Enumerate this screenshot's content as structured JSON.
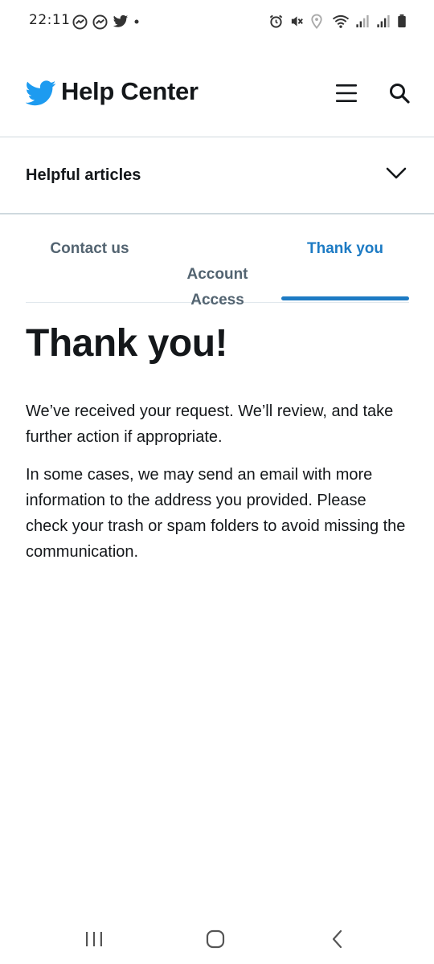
{
  "status_bar": {
    "time": "22:11",
    "left_icons": [
      "messenger-icon",
      "messenger-icon",
      "twitter-icon",
      "dot-icon"
    ],
    "right_icons": [
      "alarm-icon",
      "mute-icon",
      "location-icon",
      "wifi-icon",
      "signal-icon",
      "signal-icon",
      "battery-icon"
    ]
  },
  "header": {
    "title": "Help Center",
    "logo": "twitter-bird-icon",
    "menu_icon": "hamburger-menu-icon",
    "search_icon": "search-icon"
  },
  "helpful_articles": {
    "label": "Helpful articles",
    "icon": "chevron-down-icon"
  },
  "tabs": [
    {
      "label": "Contact us",
      "active": false
    },
    {
      "label": "Account\nAccess",
      "active": false
    },
    {
      "label": "Thank you",
      "active": true
    }
  ],
  "content": {
    "headline": "Thank you!",
    "paragraphs": [
      "We’ve received your request. We’ll review, and take further action if appropriate.",
      "In some cases, we may send an email with more information to the address you provided. Please check your trash or spam folders to avoid missing the communication."
    ]
  },
  "colors": {
    "brand_blue": "#1d9bf0",
    "active_tab": "#1d7bc4",
    "inactive_tab": "#536471",
    "text": "#14171a"
  },
  "nav_bar": {
    "recent_icon": "recent-apps-icon",
    "home_icon": "home-icon",
    "back_icon": "back-icon"
  }
}
